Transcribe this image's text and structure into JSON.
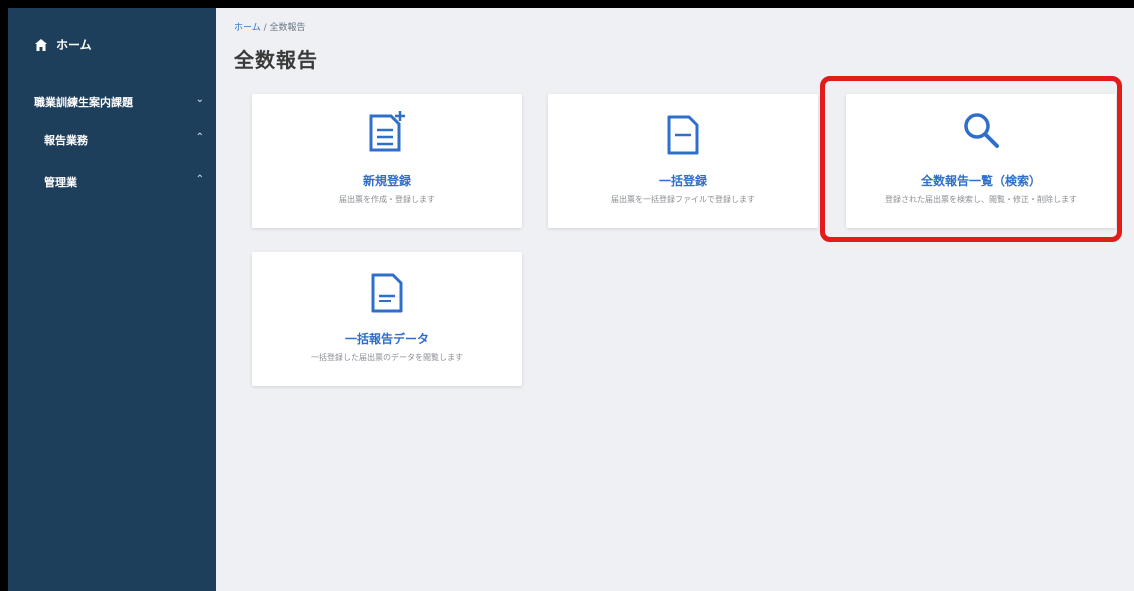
{
  "sidebar": {
    "home_label": "ホーム",
    "group_label": "職業訓練生案内課題",
    "items": [
      {
        "label": "報告業務"
      },
      {
        "label": "管理業"
      }
    ]
  },
  "breadcrumb": {
    "home": "ホーム",
    "separator": "/",
    "current": "全数報告"
  },
  "page_title": "全数報告",
  "cards": [
    {
      "title": "新規登録",
      "desc": "届出票を作成・登録します"
    },
    {
      "title": "一括登録",
      "desc": "届出票を一括登録ファイルで登録します"
    },
    {
      "title": "全数報告一覧（検索）",
      "desc": "登録された届出票を検索し、閲覧・修正・削除します"
    },
    {
      "title": "一括報告データ",
      "desc": "一括登録した届出票のデータを閲覧します"
    }
  ],
  "colors": {
    "accent": "#2f6fc9",
    "sidebar": "#1e3f5b",
    "highlight": "#e21b1b"
  }
}
